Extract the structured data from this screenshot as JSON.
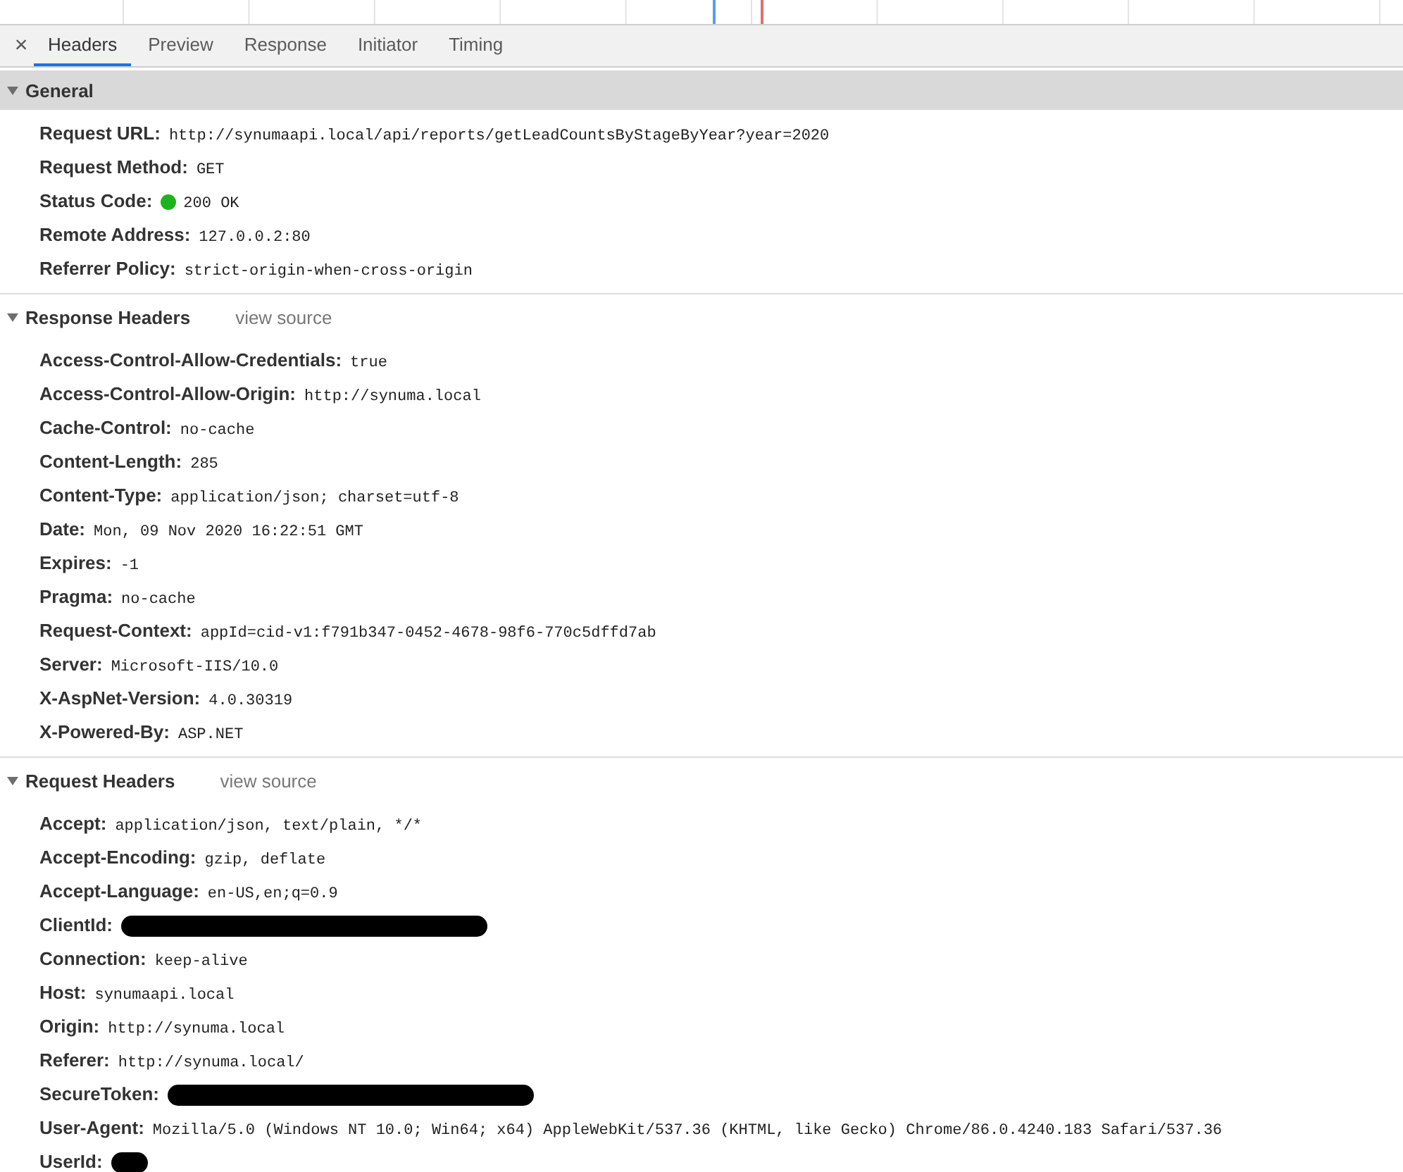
{
  "tabs": [
    {
      "label": "Headers",
      "selected": true
    },
    {
      "label": "Preview",
      "selected": false
    },
    {
      "label": "Response",
      "selected": false
    },
    {
      "label": "Initiator",
      "selected": false
    },
    {
      "label": "Timing",
      "selected": false
    }
  ],
  "close_icon": "×",
  "sections": [
    {
      "title": "General",
      "expanded": true,
      "highlighted": true,
      "rows": [
        {
          "kind": "text",
          "name": "Request URL:",
          "value": "http://synumaapi.local/api/reports/getLeadCountsByStageByYear?year=2020"
        },
        {
          "kind": "text",
          "name": "Request Method:",
          "value": "GET"
        },
        {
          "kind": "status",
          "name": "Status Code:",
          "value": "200 OK",
          "color": "#1db31d"
        },
        {
          "kind": "text",
          "name": "Remote Address:",
          "value": "127.0.0.2:80"
        },
        {
          "kind": "text",
          "name": "Referrer Policy:",
          "value": "strict-origin-when-cross-origin"
        }
      ]
    },
    {
      "title": "Response Headers",
      "link": "view source",
      "expanded": true,
      "highlighted": false,
      "rows": [
        {
          "kind": "text",
          "name": "Access-Control-Allow-Credentials:",
          "value": "true"
        },
        {
          "kind": "text",
          "name": "Access-Control-Allow-Origin:",
          "value": "http://synuma.local"
        },
        {
          "kind": "text",
          "name": "Cache-Control:",
          "value": "no-cache"
        },
        {
          "kind": "text",
          "name": "Content-Length:",
          "value": "285"
        },
        {
          "kind": "text",
          "name": "Content-Type:",
          "value": "application/json; charset=utf-8"
        },
        {
          "kind": "text",
          "name": "Date:",
          "value": "Mon, 09 Nov 2020 16:22:51 GMT"
        },
        {
          "kind": "text",
          "name": "Expires:",
          "value": "-1"
        },
        {
          "kind": "text",
          "name": "Pragma:",
          "value": "no-cache"
        },
        {
          "kind": "text",
          "name": "Request-Context:",
          "value": "appId=cid-v1:f791b347-0452-4678-98f6-770c5dffd7ab"
        },
        {
          "kind": "text",
          "name": "Server:",
          "value": "Microsoft-IIS/10.0"
        },
        {
          "kind": "text",
          "name": "X-AspNet-Version:",
          "value": "4.0.30319"
        },
        {
          "kind": "text",
          "name": "X-Powered-By:",
          "value": "ASP.NET"
        }
      ]
    },
    {
      "title": "Request Headers",
      "link": "view source",
      "expanded": true,
      "highlighted": false,
      "rows": [
        {
          "kind": "text",
          "name": "Accept:",
          "value": "application/json, text/plain, */*"
        },
        {
          "kind": "text",
          "name": "Accept-Encoding:",
          "value": "gzip, deflate"
        },
        {
          "kind": "text",
          "name": "Accept-Language:",
          "value": "en-US,en;q=0.9"
        },
        {
          "kind": "redacted",
          "name": "ClientId:"
        },
        {
          "kind": "text",
          "name": "Connection:",
          "value": "keep-alive"
        },
        {
          "kind": "text",
          "name": "Host:",
          "value": "synumaapi.local"
        },
        {
          "kind": "text",
          "name": "Origin:",
          "value": "http://synuma.local"
        },
        {
          "kind": "text",
          "name": "Referer:",
          "value": "http://synuma.local/"
        },
        {
          "kind": "redacted",
          "name": "SecureToken:"
        },
        {
          "kind": "text",
          "name": "User-Agent:",
          "value": "Mozilla/5.0 (Windows NT 10.0; Win64; x64) AppleWebKit/537.36 (KHTML, like Gecko) Chrome/86.0.4240.183 Safari/537.36"
        },
        {
          "kind": "redactedshort",
          "name": "UserId:"
        }
      ]
    }
  ]
}
